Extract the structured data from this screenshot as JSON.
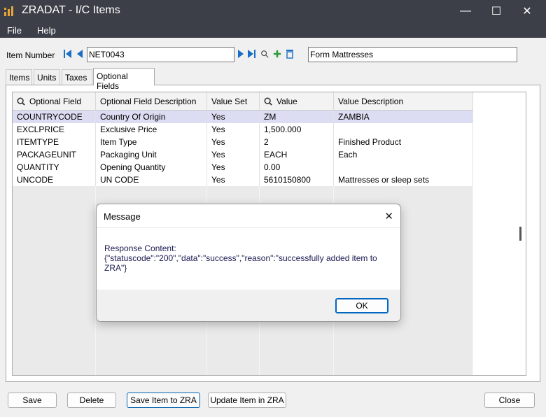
{
  "window": {
    "title": "ZRADAT - I/C Items",
    "minimize": "—",
    "maximize": "☐",
    "close": "✕"
  },
  "menu": {
    "file": "File",
    "help": "Help"
  },
  "item_row": {
    "label": "Item Number",
    "item_number": "NET0043",
    "description": "Form Mattresses"
  },
  "tabs": [
    {
      "label": "Items"
    },
    {
      "label": "Units"
    },
    {
      "label": "Taxes"
    },
    {
      "label": "Optional Fields"
    }
  ],
  "grid": {
    "columns": [
      "Optional Field",
      "Optional Field Description",
      "Value Set",
      "Value",
      "Value Description"
    ],
    "rows": [
      [
        "COUNTRYCODE",
        "Country Of Origin",
        "Yes",
        "ZM",
        "ZAMBIA"
      ],
      [
        "EXCLPRICE",
        "Exclusive Price",
        "Yes",
        "1,500.000",
        ""
      ],
      [
        "ITEMTYPE",
        "Item Type",
        "Yes",
        "2",
        "Finished Product"
      ],
      [
        "PACKAGEUNIT",
        "Packaging Unit",
        "Yes",
        "EACH",
        "Each"
      ],
      [
        "QUANTITY",
        "Opening Quantity",
        "Yes",
        "0.00",
        ""
      ],
      [
        "UNCODE",
        "UN CODE",
        "Yes",
        "5610150800",
        "Mattresses or sleep sets"
      ]
    ]
  },
  "buttons": {
    "save": "Save",
    "delete": "Delete",
    "save_zra": "Save Item to ZRA",
    "update_zra": "Update Item in ZRA",
    "close": "Close"
  },
  "dialog": {
    "title": "Message",
    "line1": "Response Content:",
    "line2": "{\"statuscode\":\"200\",\"data\":\"success\",\"reason\":\"successfully added item to",
    "line3": "ZRA\"}",
    "ok": "OK",
    "close": "✕"
  },
  "colors": {
    "titlebar": "#3c3f47",
    "selected_row": "#dcdcf2",
    "app_icon": "#e8a33a",
    "nav_blue": "#1a6fc4",
    "add_green": "#2e9c3a"
  }
}
